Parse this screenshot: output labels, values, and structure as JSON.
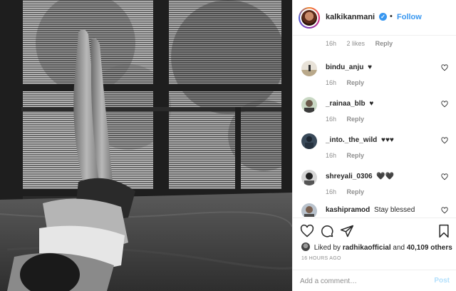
{
  "post": {
    "author": "kalkikanmani",
    "follow_label": "Follow",
    "separator": "•"
  },
  "caption_meta": {
    "time": "16h",
    "likes": "2 likes",
    "reply": "Reply"
  },
  "comments": [
    {
      "user": "bindu_anju",
      "text": "♥",
      "time": "16h",
      "reply": "Reply"
    },
    {
      "user": "_rainaa_blb",
      "text": "♥",
      "time": "16h",
      "reply": "Reply"
    },
    {
      "user": "_into._the_wild",
      "text": "♥♥♥",
      "time": "16h",
      "reply": "Reply"
    },
    {
      "user": "shreyali_0306",
      "text": "🖤🖤",
      "time": "16h",
      "reply": "Reply"
    },
    {
      "user": "kashipramod",
      "text": "Stay blessed",
      "time": "",
      "reply": ""
    }
  ],
  "likes": {
    "prefix": "Liked by",
    "user": "radhikaofficial",
    "conjunction": "and",
    "others": "40,109 others"
  },
  "timestamp": "16 HOURS AGO",
  "add_comment": {
    "placeholder": "Add a comment…",
    "post_label": "Post"
  },
  "icons": {
    "like": "heart-icon",
    "comment": "comment-icon",
    "share": "share-icon",
    "save": "bookmark-icon",
    "verified": "verified-badge-icon"
  },
  "colors": {
    "link_blue": "#3897f0",
    "muted": "#8e8e8e",
    "text": "#262626",
    "post_disabled": "#b2dffc"
  }
}
